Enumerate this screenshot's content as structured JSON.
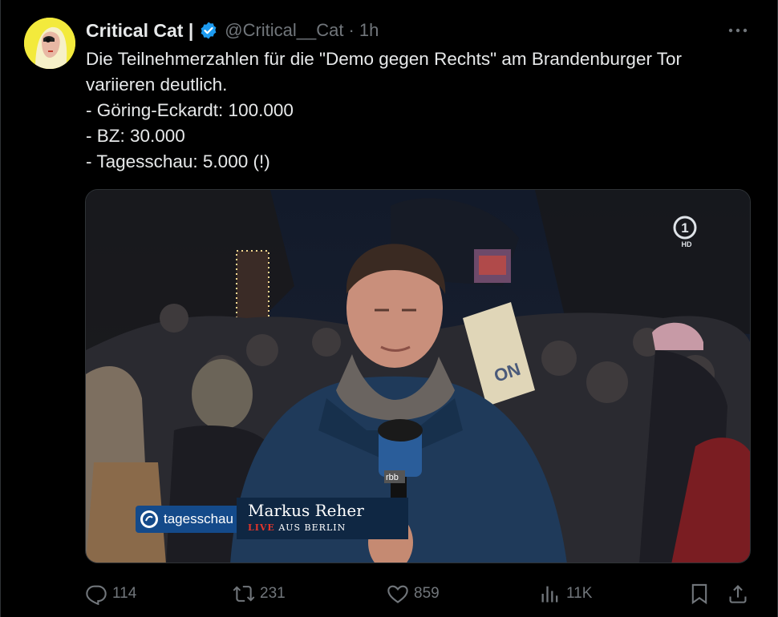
{
  "tweet": {
    "author_name": "Critical Cat |",
    "handle": "@Critical__Cat",
    "separator": "·",
    "time": "1h",
    "text_lines": [
      "Die Teilnehmerzahlen für die \"Demo gegen Rechts\" am Brandenburger Tor",
      "variieren deutlich.",
      "- Göring-Eckardt: 100.000",
      "- BZ: 30.000",
      "- Tagesschau: 5.000 (!)"
    ]
  },
  "media": {
    "brand_label": "tagesschau",
    "reporter_name": "Markus Reher",
    "live_label": "LIVE",
    "location_label": "AUS BERLIN",
    "channel_logo_text": "1",
    "channel_hd": "HD",
    "mic_label": "rbb",
    "sign_text": "ON"
  },
  "actions": {
    "replies": "114",
    "reposts": "231",
    "likes": "859",
    "views": "11K"
  },
  "colors": {
    "background": "#000000",
    "text": "#e7e9ea",
    "secondary": "#71767b",
    "verified": "#1d9bf0",
    "border": "#2f3336"
  },
  "icons": [
    "verified-badge-icon",
    "more-icon",
    "reply-icon",
    "repost-icon",
    "like-icon",
    "views-icon",
    "bookmark-icon",
    "share-icon"
  ]
}
